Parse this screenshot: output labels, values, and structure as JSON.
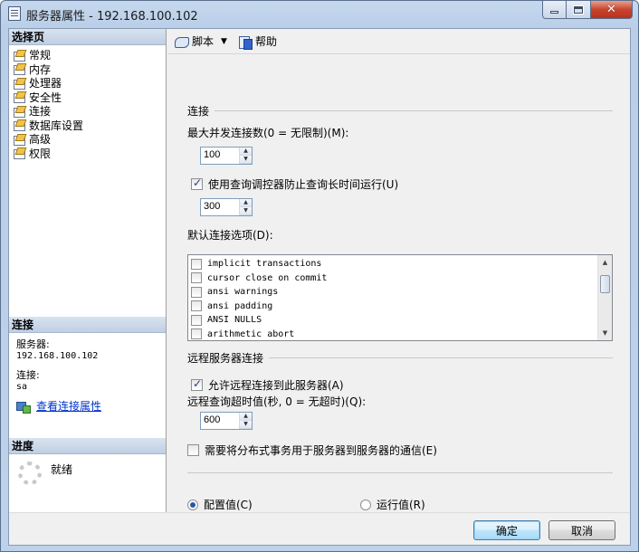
{
  "window": {
    "title": "服务器属性 - 192.168.100.102"
  },
  "sidebar": {
    "select_page_header": "选择页",
    "pages": [
      {
        "label": "常规"
      },
      {
        "label": "内存"
      },
      {
        "label": "处理器"
      },
      {
        "label": "安全性"
      },
      {
        "label": "连接"
      },
      {
        "label": "数据库设置"
      },
      {
        "label": "高级"
      },
      {
        "label": "权限"
      }
    ],
    "connection_header": "连接",
    "server_label": "服务器:",
    "server_value": "192.168.100.102",
    "connection_label": "连接:",
    "connection_value": "sa",
    "view_link": "查看连接属性",
    "progress_header": "进度",
    "progress_status": "就绪"
  },
  "toolbar": {
    "script_label": "脚本",
    "help_label": "帮助"
  },
  "connections": {
    "group_title": "连接",
    "max_connections_label": "最大并发连接数(0 = 无限制)(M):",
    "max_connections_value": "100",
    "query_governor_label": "使用查询调控器防止查询长时间运行(U)",
    "query_governor_checked": true,
    "query_governor_value": "300",
    "default_options_label": "默认连接选项(D):",
    "options": [
      {
        "label": "implicit transactions",
        "checked": false
      },
      {
        "label": "cursor close on commit",
        "checked": false
      },
      {
        "label": "ansi warnings",
        "checked": false
      },
      {
        "label": "ansi padding",
        "checked": false
      },
      {
        "label": "ANSI NULLS",
        "checked": false
      },
      {
        "label": "arithmetic abort",
        "checked": false
      }
    ]
  },
  "remote": {
    "group_title": "远程服务器连接",
    "allow_remote_label": "允许远程连接到此服务器(A)",
    "allow_remote_checked": true,
    "timeout_label": "远程查询超时值(秒, 0 = 无超时)(Q):",
    "timeout_value": "600",
    "distributed_label": "需要将分布式事务用于服务器到服务器的通信(E)",
    "distributed_checked": false
  },
  "mode": {
    "config_label": "配置值(C)",
    "running_label": "运行值(R)",
    "selected": "config"
  },
  "footer": {
    "ok_label": "确定",
    "cancel_label": "取消"
  }
}
